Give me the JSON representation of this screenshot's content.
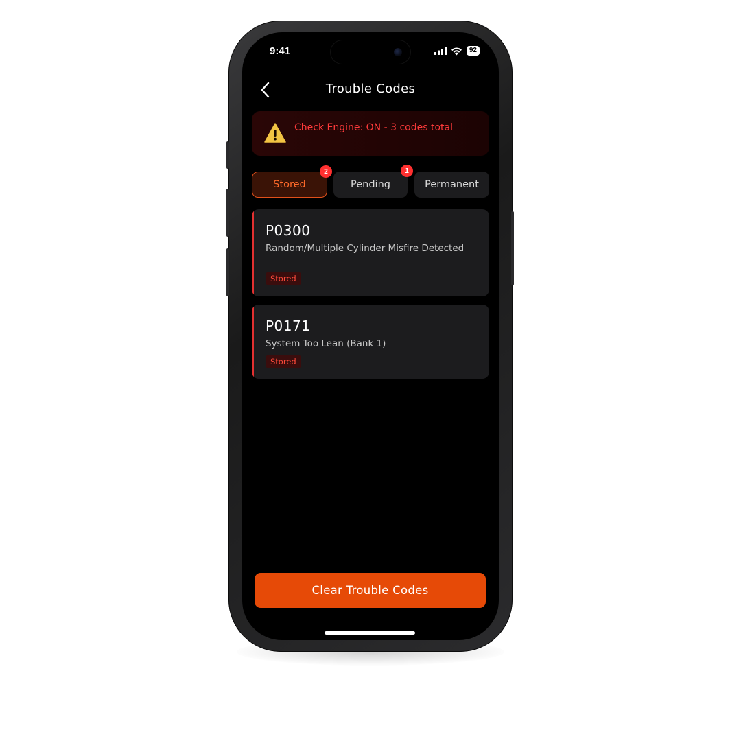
{
  "status_bar": {
    "time": "9:41",
    "battery": "92"
  },
  "nav": {
    "title": "Trouble Codes"
  },
  "alert": {
    "text": "Check Engine: ON - 3 codes total",
    "color": "#ff3b3b"
  },
  "tabs": [
    {
      "label": "Stored",
      "badge": "2",
      "active": true
    },
    {
      "label": "Pending",
      "badge": "1",
      "active": false
    },
    {
      "label": "Permanent",
      "badge": "",
      "active": false
    }
  ],
  "codes": [
    {
      "code": "P0300",
      "description": "Random/Multiple Cylinder Misfire Detected",
      "tag": "Stored"
    },
    {
      "code": "P0171",
      "description": "System Too Lean (Bank 1)",
      "tag": "Stored"
    }
  ],
  "actions": {
    "clear_label": "Clear Trouble Codes"
  },
  "colors": {
    "accent": "#e64a07",
    "danger": "#e23030",
    "background": "#000000"
  }
}
